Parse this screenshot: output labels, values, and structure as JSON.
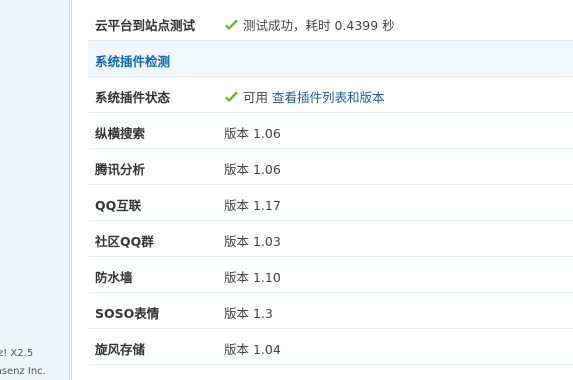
{
  "sidebar": {
    "footer_line1": "z! X2.5",
    "footer_line2": "msenz Inc."
  },
  "cloud_test": {
    "label": "云平台到站点测试",
    "status_icon": "check-icon",
    "value": "测试成功，耗时 0.4399 秒"
  },
  "section": {
    "title": "系统插件检测"
  },
  "plugin_status": {
    "label": "系统插件状态",
    "status_icon": "check-icon",
    "status_text": "可用",
    "link_text": "查看插件列表和版本"
  },
  "plugins": [
    {
      "name": "纵横搜索",
      "version": "版本 1.06"
    },
    {
      "name": "腾讯分析",
      "version": "版本 1.06"
    },
    {
      "name": "QQ互联",
      "version": "版本 1.17"
    },
    {
      "name": "社区QQ群",
      "version": "版本 1.03"
    },
    {
      "name": "防水墙",
      "version": "版本 1.10"
    },
    {
      "name": "SOSO表情",
      "version": "版本 1.3"
    },
    {
      "name": "旋风存储",
      "version": "版本 1.04"
    }
  ],
  "colors": {
    "section_title": "#0a6ca8",
    "link": "#1a5f9a",
    "check": "#5cb82f",
    "section_bg": "#f0f7fd"
  }
}
